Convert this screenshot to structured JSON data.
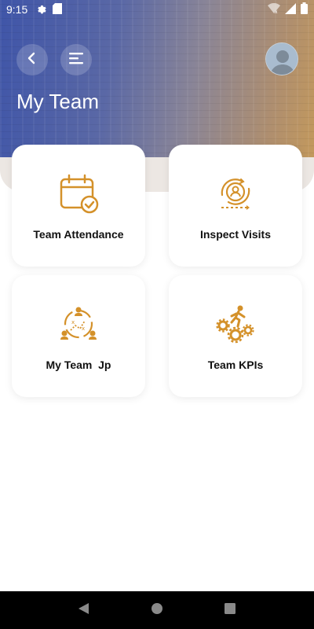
{
  "status_bar": {
    "time": "9:15",
    "icons_left": [
      "settings-icon",
      "sd-card-icon"
    ],
    "icons_right": [
      "wifi-icon",
      "signal-icon",
      "battery-icon"
    ]
  },
  "header": {
    "title": "My Team",
    "back_icon": "chevron-left-icon",
    "menu_icon": "menu-icon",
    "avatar_icon": "avatar-icon"
  },
  "tiles": [
    {
      "label": "Team Attendance",
      "icon": "calendar-check-icon"
    },
    {
      "label": "Inspect Visits",
      "icon": "user-cycle-icon"
    },
    {
      "label": "My Team  Jp",
      "icon": "team-plan-icon"
    },
    {
      "label": "Team KPIs",
      "icon": "gears-runner-icon"
    }
  ],
  "colors": {
    "accent": "#d4912a",
    "header_gradient_start": "#3f55a8",
    "header_gradient_end": "#c59a5a"
  },
  "nav_bar": {
    "buttons": [
      "back-triangle-icon",
      "home-circle-icon",
      "recents-square-icon"
    ]
  }
}
